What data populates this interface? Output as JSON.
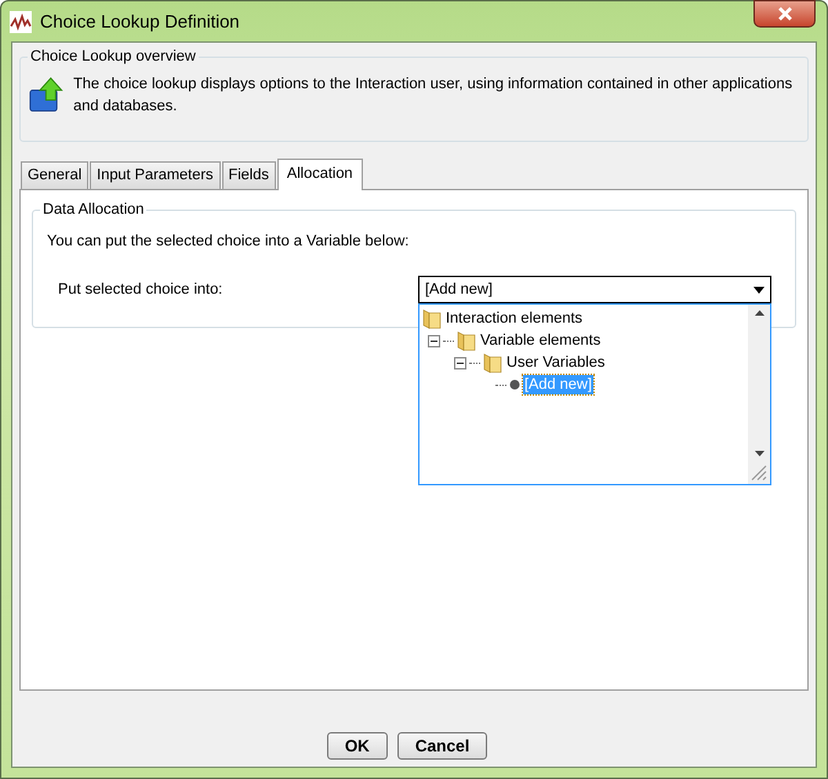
{
  "window": {
    "title": "Choice Lookup Definition"
  },
  "overview": {
    "legend": "Choice Lookup overview",
    "description": "The choice lookup displays options to the Interaction user, using information contained in other applications and databases."
  },
  "tabs": [
    {
      "label": "General",
      "selected": false
    },
    {
      "label": "Input Parameters",
      "selected": false
    },
    {
      "label": "Fields",
      "selected": false
    },
    {
      "label": "Allocation",
      "selected": true
    }
  ],
  "allocation": {
    "legend": "Data Allocation",
    "intro": "You can put the selected choice into a Variable below:",
    "field_label": "Put selected choice into:",
    "dropdown": {
      "value": "[Add new]",
      "expanded": true,
      "tree": [
        {
          "label": "Interaction elements",
          "kind": "folder",
          "selected": false,
          "children": [
            {
              "label": "Variable elements",
              "kind": "folder",
              "expanded": true,
              "selected": false,
              "children": [
                {
                  "label": "User Variables",
                  "kind": "folder",
                  "expanded": true,
                  "selected": false,
                  "children": [
                    {
                      "label": "[Add new]",
                      "kind": "leaf",
                      "selected": true
                    }
                  ]
                }
              ]
            }
          ]
        }
      ]
    }
  },
  "buttons": [
    "OK",
    "Cancel"
  ]
}
